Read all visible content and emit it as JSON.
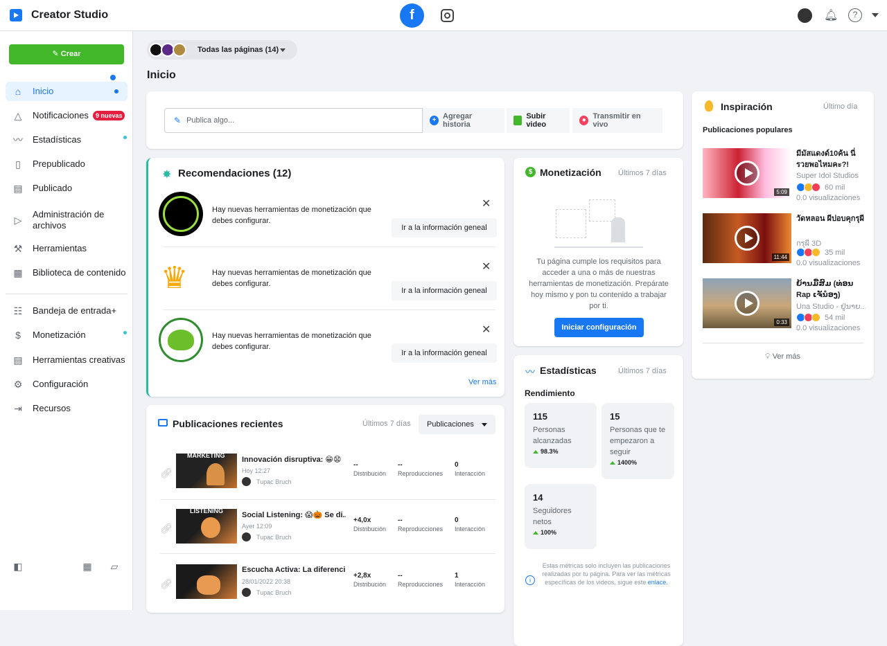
{
  "app": {
    "title": "Creator Studio"
  },
  "sidebar": {
    "create_label": "Crear",
    "items": [
      {
        "label": "Inicio"
      },
      {
        "label": "Notificaciones",
        "badge": "9 nuevas"
      },
      {
        "label": "Estadísticas"
      },
      {
        "label": "Prepublicado"
      },
      {
        "label": "Publicado"
      },
      {
        "label": "Administración de archivos"
      },
      {
        "label": "Herramientas"
      },
      {
        "label": "Biblioteca de contenido"
      },
      {
        "label": "Bandeja de entrada+"
      },
      {
        "label": "Monetización"
      },
      {
        "label": "Herramientas creativas"
      },
      {
        "label": "Configuración"
      },
      {
        "label": "Recursos"
      }
    ]
  },
  "header": {
    "page_selector": "Todas las páginas (14)",
    "page_title": "Inicio"
  },
  "composer": {
    "placeholder": "Publica algo...",
    "add_story": "Agregar historia",
    "upload_video": "Subir video",
    "go_live": "Transmitir en vivo"
  },
  "recommendations": {
    "title": "Recomendaciones (12)",
    "items": [
      {
        "text": "Hay nuevas herramientas de monetización que debes configurar.",
        "button": "Ir a la información geneal"
      },
      {
        "text": "Hay nuevas herramientas de monetización que debes configurar.",
        "button": "Ir a la información geneal"
      },
      {
        "text": "Hay nuevas herramientas de monetización que debes configurar.",
        "button": "Ir a la información geneal"
      }
    ],
    "see_more": "Ver más"
  },
  "recent_posts": {
    "title": "Publicaciones recientes",
    "range": "Últimos 7 días",
    "filter": "Publicaciones",
    "metric_labels": {
      "distribution": "Distribución",
      "plays": "Reproducciones",
      "interaction": "Interacción"
    },
    "rows": [
      {
        "thumb_label": "MARKETING",
        "title": "Innovación disruptiva: 😁😧",
        "date": "Hoy 12:27",
        "author": "Tupac Bruch",
        "distribution": "--",
        "plays": "--",
        "interaction": "0"
      },
      {
        "thumb_label": "LISTENING",
        "title": "Social Listening: 😱🎃 Se di...",
        "date": "Ayer 12:09",
        "author": "Tupac Bruch",
        "distribution": "+4,0x",
        "plays": "--",
        "interaction": "0"
      },
      {
        "thumb_label": "",
        "title": "Escucha Activa: La diferenci...",
        "date": "28/01/2022 20:38",
        "author": "Tupac Bruch",
        "distribution": "+2,8x",
        "plays": "--",
        "interaction": "1"
      }
    ]
  },
  "monetization": {
    "title": "Monetización",
    "range": "Últimos 7 días",
    "text": "Tu página cumple los requisitos para acceder a una o más de nuestras herramientas de monetización. Prepárate hoy mismo y pon tu contenido a trabajar por ti.",
    "button": "Iniciar configuración"
  },
  "stats": {
    "title": "Estadísticas",
    "range": "Últimos 7 días",
    "section": "Rendimiento",
    "boxes": [
      {
        "num": "115",
        "desc": "Personas alcanzadas",
        "pct": "98.3%"
      },
      {
        "num": "15",
        "desc": "Personas que te empezaron a seguir",
        "pct": "1400%"
      },
      {
        "num": "14",
        "desc": "Seguidores netos",
        "pct": "100%"
      }
    ],
    "note": "Estas métricas solo incluyen las publicaciones realizadas por tu página. Para ver las métricas específicas de los videos, sigue este",
    "note_link": "enlace."
  },
  "inspiration": {
    "title": "Inspiración",
    "range": "Último día",
    "section": "Publicaciones populares",
    "items": [
      {
        "title": "มีมัสแดงด์10ค้น นี่รวยพอไหมคะ?!",
        "source": "Super Idol Studios",
        "reactions": "60 mil",
        "views": "0.0 visualizaciones",
        "duration": "5:09"
      },
      {
        "title": "วัดหลอน ผีปอบคุกรุผี",
        "source": "กรุผี 3D",
        "reactions": "35 mil",
        "views": "0.0 visualizaciones",
        "duration": "11:44"
      },
      {
        "title": "ຍ້ານມື້ສົມ (ທ່ອນ Rap ເຈັນ໋ອງ)",
        "source": "Una Studio - ຢູ່ນາຍ...",
        "reactions": "54 mil",
        "views": "0.0 visualizaciones",
        "duration": "0:33"
      }
    ],
    "see_more": "Ver más"
  }
}
